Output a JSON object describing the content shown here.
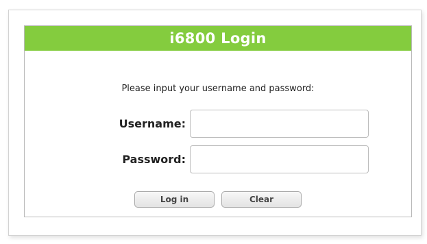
{
  "login": {
    "title": "i6800 Login",
    "prompt": "Please input your username and password:",
    "username_label": "Username:",
    "username_value": "",
    "password_label": "Password:",
    "password_value": "",
    "login_button": "Log in",
    "clear_button": "Clear"
  },
  "colors": {
    "header": "#84cc3e",
    "header_text": "#ffffff"
  }
}
